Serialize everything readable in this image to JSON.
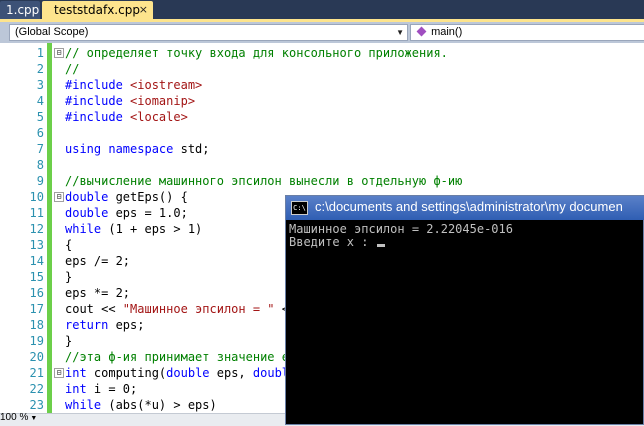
{
  "tabs": [
    {
      "label": "1.cpp",
      "active": false
    },
    {
      "label": "teststdafx.cpp",
      "active": true,
      "close": "×"
    }
  ],
  "navbar": {
    "scope": "(Global Scope)",
    "member": "main()"
  },
  "code": [
    {
      "n": "1",
      "fold": "⊟",
      "parts": [
        [
          "cm",
          "// определяет точку входа для консольного приложения."
        ]
      ]
    },
    {
      "n": "2",
      "parts": [
        [
          "cm",
          "//"
        ]
      ]
    },
    {
      "n": "3",
      "parts": [
        [
          "pp",
          "#include "
        ],
        [
          "st",
          "<iostream>"
        ]
      ]
    },
    {
      "n": "4",
      "parts": [
        [
          "pp",
          "#include "
        ],
        [
          "st",
          "<iomanip>"
        ]
      ]
    },
    {
      "n": "5",
      "parts": [
        [
          "pp",
          "#include "
        ],
        [
          "st",
          "<locale>"
        ]
      ]
    },
    {
      "n": "6",
      "parts": []
    },
    {
      "n": "7",
      "parts": [
        [
          "kw",
          "using namespace"
        ],
        [
          "df",
          " std;"
        ]
      ]
    },
    {
      "n": "8",
      "parts": []
    },
    {
      "n": "9",
      "parts": [
        [
          "cm",
          "//вычисление машинного эпсилон вынесли в отдельную ф-ию"
        ]
      ]
    },
    {
      "n": "10",
      "fold": "⊟",
      "parts": [
        [
          "kw",
          "double"
        ],
        [
          "df",
          " getEps() {"
        ]
      ]
    },
    {
      "n": "11",
      "parts": [
        [
          "kw",
          "double"
        ],
        [
          "df",
          " eps = 1.0;"
        ]
      ]
    },
    {
      "n": "12",
      "parts": [
        [
          "kw",
          "while"
        ],
        [
          "df",
          " (1 + eps > 1)"
        ]
      ]
    },
    {
      "n": "13",
      "parts": [
        [
          "df",
          "{"
        ]
      ]
    },
    {
      "n": "14",
      "parts": [
        [
          "df",
          "eps /= 2;"
        ]
      ]
    },
    {
      "n": "15",
      "parts": [
        [
          "df",
          "}"
        ]
      ]
    },
    {
      "n": "16",
      "parts": [
        [
          "df",
          "eps *= 2;"
        ]
      ]
    },
    {
      "n": "17",
      "parts": [
        [
          "df",
          "cout << "
        ],
        [
          "st",
          "\"Машинное эпсилон = \""
        ],
        [
          "df",
          " <"
        ]
      ]
    },
    {
      "n": "18",
      "parts": [
        [
          "kw",
          "return"
        ],
        [
          "df",
          " eps;"
        ]
      ]
    },
    {
      "n": "19",
      "parts": [
        [
          "df",
          "}"
        ]
      ]
    },
    {
      "n": "20",
      "parts": [
        [
          "cm",
          "//эта ф-ия принимает значение е"
        ]
      ]
    },
    {
      "n": "21",
      "fold": "⊟",
      "parts": [
        [
          "kw",
          "int"
        ],
        [
          "df",
          " computing("
        ],
        [
          "kw",
          "double"
        ],
        [
          "df",
          " eps, "
        ],
        [
          "kw",
          "doubl"
        ]
      ]
    },
    {
      "n": "22",
      "parts": [
        [
          "kw",
          "int"
        ],
        [
          "df",
          " i = 0;"
        ]
      ]
    },
    {
      "n": "23",
      "parts": [
        [
          "kw",
          "while"
        ],
        [
          "df",
          " (abs(*u) > eps)"
        ]
      ]
    }
  ],
  "statusbar": {
    "zoom": "100 %"
  },
  "console": {
    "icon": "C:\\",
    "title": "c:\\documents and settings\\administrator\\my documen",
    "lines": [
      "Машинное эпсилон = 2.22045e-016",
      "Введите x : "
    ]
  },
  "colors": {
    "tab_strip": "#293955",
    "active_tab": "#fde48d",
    "keyword": "#0000ff",
    "comment": "#008000",
    "string": "#a31515",
    "line_number": "#2b91af",
    "change_bar": "#6ccf4a",
    "console_bg": "#000000",
    "console_text": "#c0c0c0",
    "console_title": "#2f5eb3"
  }
}
